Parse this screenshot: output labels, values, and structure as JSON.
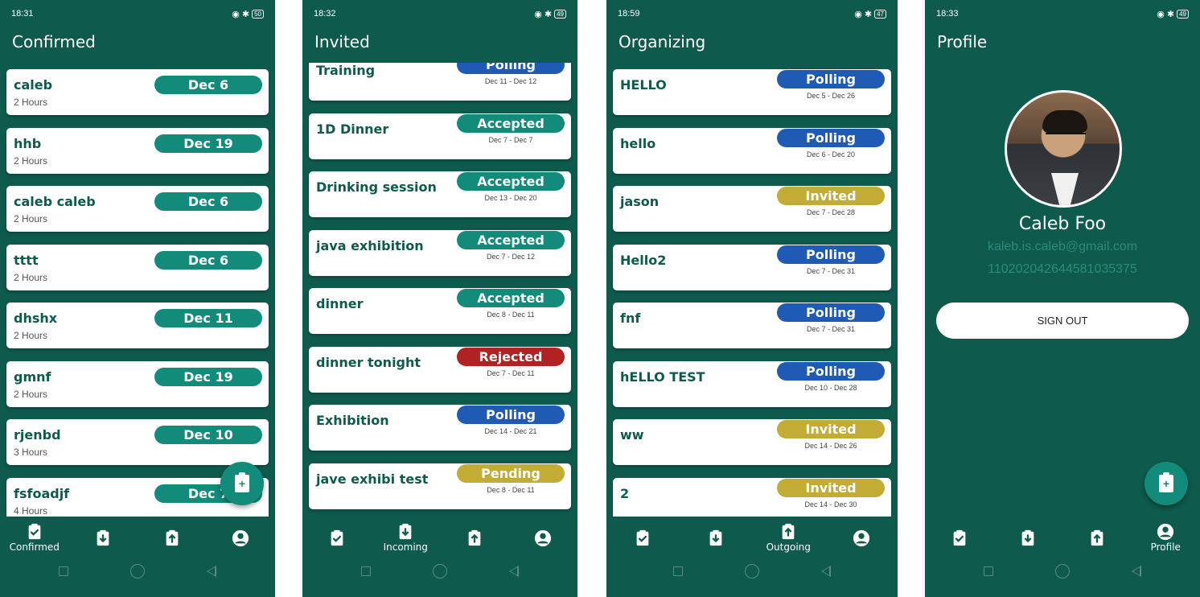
{
  "colors": {
    "background": "#0e5a4d",
    "confirmed": "#128b7a",
    "accepted": "#128b7a",
    "polling": "#1f5bb4",
    "invited": "#c2ac36",
    "pending": "#c2ac36",
    "rejected": "#b22222"
  },
  "nav_labels": {
    "confirmed": "Confirmed",
    "incoming": "Incoming",
    "outgoing": "Outgoing",
    "profile": "Profile"
  },
  "screens": [
    {
      "status": {
        "time": "18:31",
        "battery": "50"
      },
      "title": "Confirmed",
      "items": [
        {
          "name": "caleb",
          "badge": "Dec 6",
          "sub": "2 Hours"
        },
        {
          "name": "hhb",
          "badge": "Dec 19",
          "sub": "2 Hours"
        },
        {
          "name": "caleb caleb",
          "badge": "Dec 6",
          "sub": "2 Hours"
        },
        {
          "name": "tttt",
          "badge": "Dec 6",
          "sub": "2 Hours"
        },
        {
          "name": "dhshx",
          "badge": "Dec 11",
          "sub": "2 Hours"
        },
        {
          "name": "gmnf",
          "badge": "Dec 19",
          "sub": "2 Hours"
        },
        {
          "name": "rjenbd",
          "badge": "Dec 10",
          "sub": "3 Hours"
        },
        {
          "name": "fsfoadjf",
          "badge": "Dec 7",
          "sub": "4 Hours"
        }
      ]
    },
    {
      "status": {
        "time": "18:32",
        "battery": "49"
      },
      "title": "Invited",
      "items": [
        {
          "name": "Training",
          "badge": "Polling",
          "dates": "Dec 11 - Dec 12"
        },
        {
          "name": "1D Dinner",
          "badge": "Accepted",
          "dates": "Dec 7 - Dec 7"
        },
        {
          "name": "Drinking session",
          "badge": "Accepted",
          "dates": "Dec 13 - Dec 20"
        },
        {
          "name": "java exhibition",
          "badge": "Accepted",
          "dates": "Dec 7 - Dec 12"
        },
        {
          "name": "dinner",
          "badge": "Accepted",
          "dates": "Dec 8 - Dec 11"
        },
        {
          "name": "dinner tonight",
          "badge": "Rejected",
          "dates": "Dec 7 - Dec 11"
        },
        {
          "name": "Exhibition",
          "badge": "Polling",
          "dates": "Dec 14 - Dec 21"
        },
        {
          "name": "jave exhibi test",
          "badge": "Pending",
          "dates": "Dec 8 - Dec 11"
        }
      ]
    },
    {
      "status": {
        "time": "18:59",
        "battery": "47"
      },
      "title": "Organizing",
      "items": [
        {
          "name": "HELLO",
          "badge": "Polling",
          "dates": "Dec 5 - Dec 26"
        },
        {
          "name": "hello",
          "badge": "Polling",
          "dates": "Dec 6 - Dec 20"
        },
        {
          "name": "jason",
          "badge": "Invited",
          "dates": "Dec 7 - Dec 28"
        },
        {
          "name": "Hello2",
          "badge": "Polling",
          "dates": "Dec 7 - Dec 31"
        },
        {
          "name": "fnf",
          "badge": "Polling",
          "dates": "Dec 7 - Dec 31"
        },
        {
          "name": "hELLO TEST",
          "badge": "Polling",
          "dates": "Dec 10 - Dec 28"
        },
        {
          "name": "ww",
          "badge": "Invited",
          "dates": "Dec 14 - Dec 26"
        },
        {
          "name": "2",
          "badge": "Invited",
          "dates": "Dec 14 - Dec 30"
        }
      ]
    },
    {
      "status": {
        "time": "18:33",
        "battery": "49"
      },
      "title": "Profile",
      "profile": {
        "name": "Caleb Foo",
        "email": "kaleb.is.caleb@gmail.com",
        "id": "110202042644581035375",
        "signout": "SIGN OUT"
      }
    }
  ]
}
